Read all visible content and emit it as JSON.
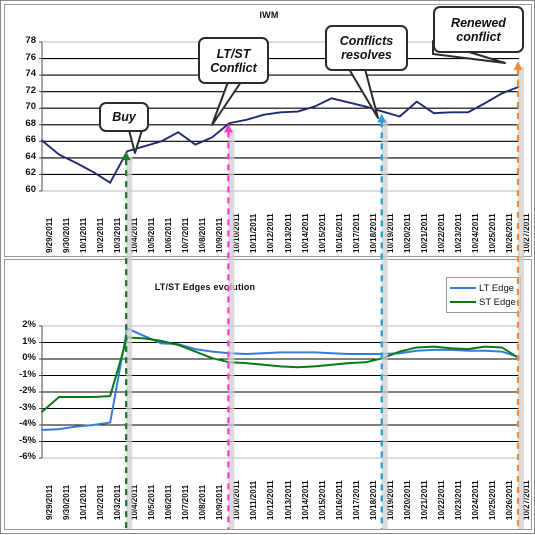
{
  "colors": {
    "price_line": "#1f2a70",
    "lt_edge": "#3a7ae0",
    "st_edge": "#0a7a16",
    "arrow_buy": "#1f7a2e",
    "arrow_conflict": "#ff3ad1",
    "arrow_resolve": "#2e9bd6",
    "arrow_renewed": "#f08a3c",
    "grid": "#000000",
    "frame": "#9a9a9a",
    "callout_border": "#2b2b2b"
  },
  "top_chart": {
    "title": "IWM",
    "y_ticks": [
      "78",
      "76",
      "74",
      "72",
      "70",
      "68",
      "66",
      "64",
      "62",
      "60"
    ]
  },
  "bottom_chart": {
    "title": "LT/ST Edges evolution",
    "y_ticks": [
      "2%",
      "1%",
      "0%",
      "-1%",
      "-2%",
      "-3%",
      "-4%",
      "-5%",
      "-6%"
    ],
    "legend": [
      {
        "label": "LT Edge",
        "color": "#3a7ae0"
      },
      {
        "label": "ST Edge",
        "color": "#0a7a16"
      }
    ]
  },
  "x_labels": [
    "9/29/2011",
    "9/30/2011",
    "10/1/2011",
    "10/2/2011",
    "10/3/2011",
    "10/4/2011",
    "10/5/2011",
    "10/6/2011",
    "10/7/2011",
    "10/8/2011",
    "10/9/2011",
    "10/10/2011",
    "10/11/2011",
    "10/12/2011",
    "10/13/2011",
    "10/14/2011",
    "10/15/2011",
    "10/16/2011",
    "10/17/2011",
    "10/18/2011",
    "10/19/2011",
    "10/20/2011",
    "10/21/2011",
    "10/22/2011",
    "10/23/2011",
    "10/24/2011",
    "10/25/2011",
    "10/26/2011",
    "10/27/2011"
  ],
  "annotations": [
    {
      "name": "buy",
      "text": "Buy",
      "date": "10/4/2011",
      "color": "#1f7a2e"
    },
    {
      "name": "lt-st-conflict",
      "text": "LT/ST Conflict",
      "date": "10/10/2011",
      "color": "#ff3ad1"
    },
    {
      "name": "conflicts-resolves",
      "text": "Conflicts resolves",
      "date": "10/19/2011",
      "color": "#2e9bd6"
    },
    {
      "name": "renewed-conflict",
      "text": "Renewed conflict",
      "date": "10/27/2011",
      "color": "#f08a3c"
    }
  ],
  "chart_data": [
    {
      "type": "line",
      "title": "IWM",
      "xlabel": "",
      "ylabel": "",
      "ylim": [
        60,
        78
      ],
      "grid": true,
      "legend": "none",
      "x": [
        "9/29/2011",
        "9/30/2011",
        "10/1/2011",
        "10/2/2011",
        "10/3/2011",
        "10/4/2011",
        "10/5/2011",
        "10/6/2011",
        "10/7/2011",
        "10/8/2011",
        "10/9/2011",
        "10/10/2011",
        "10/11/2011",
        "10/12/2011",
        "10/13/2011",
        "10/14/2011",
        "10/15/2011",
        "10/16/2011",
        "10/17/2011",
        "10/18/2011",
        "10/19/2011",
        "10/20/2011",
        "10/21/2011",
        "10/22/2011",
        "10/23/2011",
        "10/24/2011",
        "10/25/2011",
        "10/26/2011",
        "10/27/2011"
      ],
      "series": [
        {
          "name": "IWM",
          "color": "#1f2a70",
          "values": [
            66.1,
            64.4,
            63.4,
            62.3,
            61.0,
            64.8,
            65.4,
            66.0,
            67.1,
            65.6,
            66.5,
            68.2,
            68.6,
            69.2,
            69.5,
            69.6,
            70.2,
            71.2,
            70.7,
            70.2,
            69.6,
            69.0,
            70.8,
            69.4,
            69.5,
            69.5,
            70.6,
            71.8,
            72.6
          ]
        }
      ],
      "note": "x positions are daily; series is the IWM price series plotted in the upper panel"
    },
    {
      "type": "line",
      "title": "LT/ST Edges evolution",
      "xlabel": "",
      "ylabel": "",
      "ylim": [
        -6,
        2
      ],
      "yunit": "%",
      "grid": true,
      "legend": "top-right",
      "x": [
        "9/29/2011",
        "9/30/2011",
        "10/1/2011",
        "10/2/2011",
        "10/3/2011",
        "10/4/2011",
        "10/5/2011",
        "10/6/2011",
        "10/7/2011",
        "10/8/2011",
        "10/9/2011",
        "10/10/2011",
        "10/11/2011",
        "10/12/2011",
        "10/13/2011",
        "10/14/2011",
        "10/15/2011",
        "10/16/2011",
        "10/17/2011",
        "10/18/2011",
        "10/19/2011",
        "10/20/2011",
        "10/21/2011",
        "10/22/2011",
        "10/23/2011",
        "10/24/2011",
        "10/25/2011",
        "10/26/2011",
        "10/27/2011"
      ],
      "series": [
        {
          "name": "LT Edge",
          "color": "#3a7ae0",
          "values": [
            -4.3,
            -4.25,
            -4.1,
            -4.0,
            -3.85,
            1.85,
            1.4,
            0.95,
            0.9,
            0.6,
            0.45,
            0.35,
            0.3,
            0.35,
            0.4,
            0.4,
            0.4,
            0.35,
            0.3,
            0.3,
            0.3,
            0.35,
            0.5,
            0.55,
            0.55,
            0.5,
            0.5,
            0.45,
            0.1
          ]
        },
        {
          "name": "ST Edge",
          "color": "#0a7a16",
          "values": [
            -3.2,
            -2.3,
            -2.3,
            -2.3,
            -2.25,
            1.3,
            1.25,
            1.1,
            0.85,
            0.45,
            0.05,
            -0.2,
            -0.25,
            -0.35,
            -0.45,
            -0.5,
            -0.45,
            -0.35,
            -0.25,
            -0.2,
            0.05,
            0.45,
            0.7,
            0.75,
            0.65,
            0.6,
            0.75,
            0.7,
            0.05
          ]
        }
      ]
    }
  ]
}
